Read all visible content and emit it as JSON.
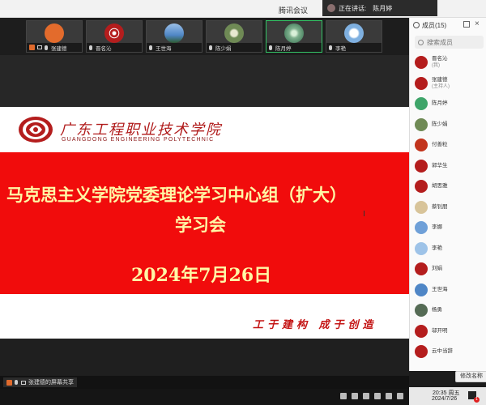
{
  "app": {
    "title": "腾讯会议"
  },
  "speaking": {
    "label": "正在讲话:",
    "name": "陈月婷"
  },
  "participants": [
    {
      "name": "张建德",
      "avatar_color": "#e36b2c",
      "kind": "host"
    },
    {
      "name": "晋名沁",
      "avatar_color": "#b41d1d",
      "kind": "seal"
    },
    {
      "name": "王世海",
      "avatar_color": "#4f86c6",
      "kind": "photo"
    },
    {
      "name": "陈少娟",
      "avatar_color": "#6f8a55",
      "kind": "photo"
    },
    {
      "name": "陈月婷",
      "avatar_color": "#7fb08e",
      "kind": "photo"
    },
    {
      "name": "李艳",
      "avatar_color": "#7fb0e0",
      "kind": "photo"
    }
  ],
  "slide": {
    "school_cn": "广东工程职业技术学院",
    "school_en": "GUANGDONG ENGINEERING POLYTECHNIC",
    "title_line1": "马克思主义学院党委理论学习中心组（扩大）",
    "title_line2": "学习会",
    "date": "2024年7月26日",
    "slogan": "工于建构 成于创造",
    "band_color": "#f10c0c",
    "text_color": "#fff8a6"
  },
  "share": {
    "label": "张建德的屏幕共享"
  },
  "sidebar": {
    "header": "成员(15)",
    "search_placeholder": "搜索成员",
    "members": [
      {
        "name": "晋名沁",
        "role": "(我)",
        "avatar_color": "#b41d1d"
      },
      {
        "name": "张建德",
        "role": "(主持人)",
        "avatar_color": "#b41d1d"
      },
      {
        "name": "陈月婷",
        "role": "",
        "avatar_color": "#3fa56a"
      },
      {
        "name": "陈少娟",
        "role": "",
        "avatar_color": "#6f8a55"
      },
      {
        "name": "付善粒",
        "role": "",
        "avatar_color": "#c2341c"
      },
      {
        "name": "郭华生",
        "role": "",
        "avatar_color": "#b41d1d"
      },
      {
        "name": "胡思雅",
        "role": "",
        "avatar_color": "#b41d1d"
      },
      {
        "name": "蔡钊朋",
        "role": "",
        "avatar_color": "#d8c49a"
      },
      {
        "name": "李娜",
        "role": "",
        "avatar_color": "#6fa0d8"
      },
      {
        "name": "李艳",
        "role": "",
        "avatar_color": "#9ec3e8"
      },
      {
        "name": "刘娟",
        "role": "",
        "avatar_color": "#b41d1d"
      },
      {
        "name": "王世海",
        "role": "",
        "avatar_color": "#4f86c6"
      },
      {
        "name": "杨勇",
        "role": "",
        "avatar_color": "#556b55"
      },
      {
        "name": "邬开明",
        "role": "",
        "avatar_color": "#b41d1d"
      },
      {
        "name": "云中当辞",
        "role": "",
        "avatar_color": "#b41d1d"
      }
    ],
    "rename_label": "修改名称"
  },
  "taskbar": {
    "time": "20:35 周五",
    "date": "2024/7/26",
    "badge": "1"
  }
}
